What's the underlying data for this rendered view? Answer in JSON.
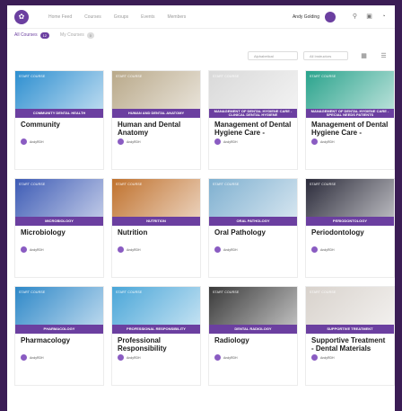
{
  "header": {
    "nav": [
      "Home Feed",
      "Courses",
      "Groups",
      "Events",
      "Members"
    ],
    "user_name": "Andy Golding",
    "icons": [
      "search-icon",
      "cart-icon",
      "bell-icon"
    ]
  },
  "filters": [
    {
      "label": "All Courses",
      "count": "12"
    },
    {
      "label": "My Courses",
      "count": "0"
    }
  ],
  "controls": {
    "sort": "Alphabetical",
    "instructors": "All Instructors"
  },
  "courses": [
    {
      "badge": "START COURSE",
      "band": "COMMUNITY DENTAL HEALTH",
      "title": "Community",
      "author": "AndyRDH",
      "thumb_color": "#2e8fd0"
    },
    {
      "badge": "START COURSE",
      "band": "HUMAN AND DENTAL ANATOMY",
      "title": "Human and Dental Anatomy",
      "author": "AndyRDH",
      "thumb_color": "#b9a98a"
    },
    {
      "badge": "START COURSE",
      "band": "MANAGEMENT OF DENTAL HYGIENE CARE - CLINICAL DENTAL HYGIENE",
      "title": "Management of Dental Hygiene Care - Clinic...",
      "author": "AndyRDH",
      "thumb_color": "#d9d9d9"
    },
    {
      "badge": "START COURSE",
      "band": "MANAGEMENT OF DENTAL HYGIENE CARE - SPECIAL NEEDS PATIENTS",
      "title": "Management of Dental Hygiene Care - Speci...",
      "author": "AndyRDH",
      "thumb_color": "#2aa38c"
    },
    {
      "badge": "START COURSE",
      "band": "MICROBIOLOGY",
      "title": "Microbiology",
      "author": "AndyRDH",
      "thumb_color": "#3d5bb5"
    },
    {
      "badge": "START COURSE",
      "band": "NUTRITION",
      "title": "Nutrition",
      "author": "AndyRDH",
      "thumb_color": "#c0722e"
    },
    {
      "badge": "START COURSE",
      "band": "ORAL PATHOLOGY",
      "title": "Oral Pathology",
      "author": "AndyRDH",
      "thumb_color": "#7fb0d0"
    },
    {
      "badge": "START COURSE",
      "band": "PERIODONTOLOGY",
      "title": "Periodontology",
      "author": "AndyRDH",
      "thumb_color": "#2b2b3a"
    },
    {
      "badge": "START COURSE",
      "band": "PHARMACOLOGY",
      "title": "Pharmacology",
      "author": "AndyRDH",
      "thumb_color": "#2e88c8"
    },
    {
      "badge": "START COURSE",
      "band": "PROFESSIONAL RESPONSIBILITY",
      "title": "Professional Responsibility",
      "author": "AndyRDH",
      "thumb_color": "#4aa6d8"
    },
    {
      "badge": "START COURSE",
      "band": "DENTAL RADIOLOGY",
      "title": "Radiology",
      "author": "AndyRDH",
      "thumb_color": "#3a3a3a"
    },
    {
      "badge": "START COURSE",
      "band": "SUPPORTIVE TREATMENT",
      "title": "Supportive Treatment - Dental Materials",
      "author": "AndyRDH",
      "thumb_color": "#d8d2cc"
    }
  ],
  "accent": "#6b3fa0"
}
